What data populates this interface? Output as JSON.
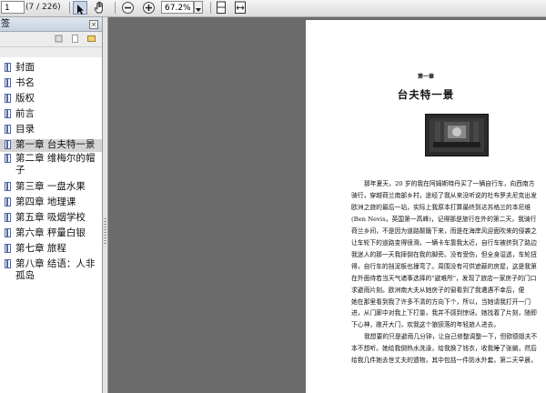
{
  "toolbar": {
    "page_current": "1",
    "page_count": "(7 / 226)",
    "zoom_value": "67.2%",
    "icons": [
      "select-tool-icon",
      "hand-tool-icon",
      "zoom-out-icon",
      "zoom-in-icon",
      "zoom-dropdown-icon",
      "fit-page-icon",
      "fit-width-icon"
    ]
  },
  "sidebar": {
    "title": "签",
    "close_glyph": "×",
    "bookmarks": [
      {
        "label": "封面"
      },
      {
        "label": "书名"
      },
      {
        "label": "版权"
      },
      {
        "label": "前言"
      },
      {
        "label": "目录"
      },
      {
        "label": "第一章 台夫特一景"
      },
      {
        "label": "第二章 维梅尔的帽子"
      },
      {
        "label": "第三章 一盘水果"
      },
      {
        "label": "第四章 地理课"
      },
      {
        "label": "第五章 吸烟学校"
      },
      {
        "label": "第六章 秤量白银"
      },
      {
        "label": "第七章 旅程"
      },
      {
        "label": "第八章 结语：人非孤岛"
      }
    ]
  },
  "document": {
    "chapter_label": "第一章",
    "chapter_title": "台夫特一景",
    "paragraphs": [
      "那年夏天，20 岁的我在阿姆斯特丹买了一辆自行车，向西南方",
      "骑行，穿越荷兰南部乡村，途经了我从来没听说的杜布罗夫尼克出发",
      "欧洲之旅的最后一站，实际上我原本打算最终到达苏格兰的本尼维",
      "(Ben Nevis，英国第一高峰)，记得那是旅行在外的第二天，我骑行",
      "荷兰乡间，不是因为道路颠簸下来，而是在海岸风迎面吹来的侵袭之",
      "让车轮下的道路变得很滑。一辆卡车靠我太近，自行车被挤到了路边",
      "我迷人的那一天我摔倒在我的脚旁。没有受伤，但全身湿透，车轮扭",
      "得，自行车的挡泥板也撞弯了。周围没有可供遮蔽的房屋，这是我第",
      "在外面待若当天气诸事选择的\"避难所\"，发现了旅店一家房子的门口",
      "求避雨片刻。欧洲南大夫从她房子的窗看到了我遭遇不幸后，便",
      "她在那里看到我了许多不清的方向下个，所以，当她请我打开一门",
      "进，从门廊中对我上下打量，我并不感到惊讶。她找着了片刻，随即",
      "下心神，敞开大门，欢我这个狼狈落的年轻旅人进去。",
      "我想要的只是避雨几分钟，让自己修整调整一下，但欧德姐夫不",
      "本不想听。她给我倒热水洗澡，给我换了钱衣，收我睡了张躺，然后",
      "给我几件她去世丈夫的遗物，其中包括一件防水外套。第二天早晨，"
    ]
  }
}
